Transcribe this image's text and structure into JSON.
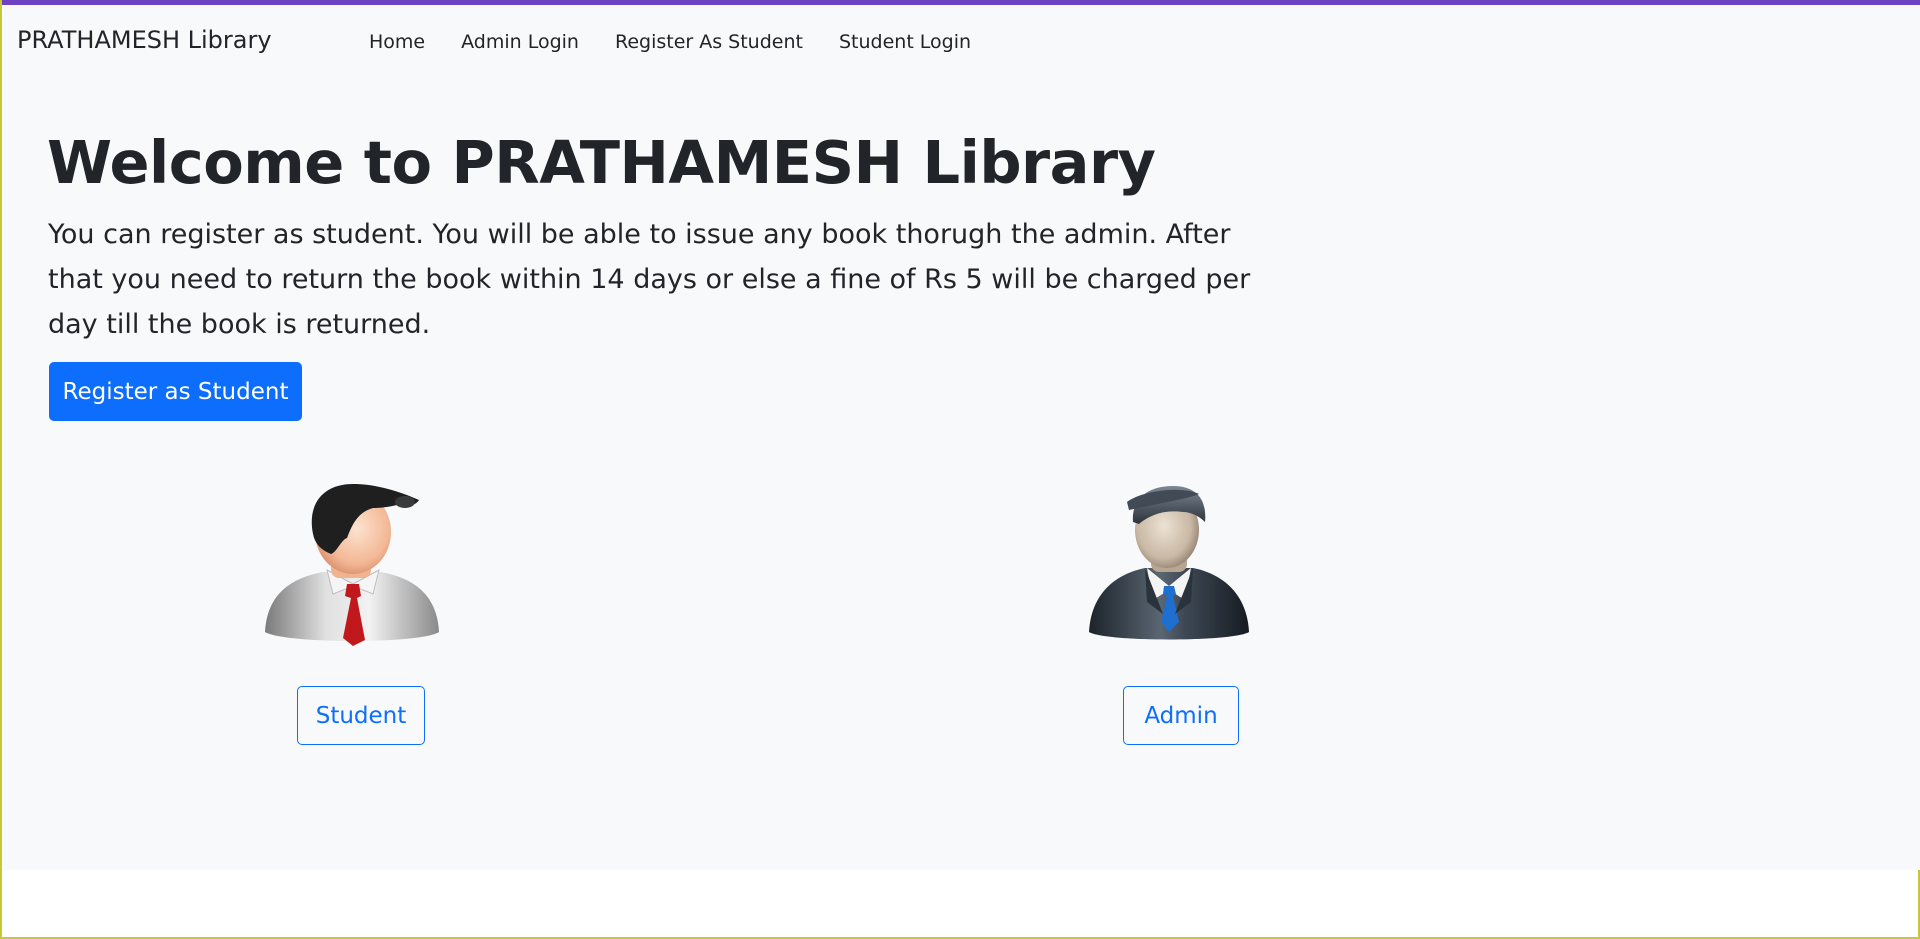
{
  "navbar": {
    "brand": "PRATHAMESH Library",
    "links": [
      "Home",
      "Admin Login",
      "Register As Student",
      "Student Login"
    ]
  },
  "hero": {
    "title": "Welcome to PRATHAMESH Library",
    "description": "You can register as student. You will be able to issue any book thorugh the admin. After that you need to return the book within 14 days or else a fine of Rs 5 will be charged per day till the book is returned.",
    "register_button": "Register as Student"
  },
  "cards": {
    "student": {
      "icon": "student-avatar-icon",
      "button": "Student"
    },
    "admin": {
      "icon": "admin-avatar-icon",
      "button": "Admin"
    }
  },
  "colors": {
    "accent_bar": "#6f42c1",
    "primary": "#0d6efd",
    "background": "#f8f9fa",
    "window_border": "#c8c832"
  }
}
